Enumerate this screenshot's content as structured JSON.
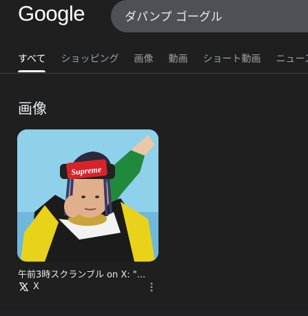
{
  "header": {
    "logo_text": "Google",
    "search_query": "ダパンプ ゴーグル"
  },
  "tabs": [
    {
      "label": "すべて",
      "active": true
    },
    {
      "label": "ショッピング",
      "active": false
    },
    {
      "label": "画像",
      "active": false
    },
    {
      "label": "動画",
      "active": false
    },
    {
      "label": "ショート動画",
      "active": false
    },
    {
      "label": "ニュース",
      "active": false
    }
  ],
  "images_section": {
    "title": "画像",
    "result": {
      "title": "午前3時スクランブル on X: \"...",
      "source": "X",
      "source_icon": "x-logo-icon",
      "thumbnail_text": "Supreme"
    }
  },
  "colors": {
    "background": "#1f1f1f",
    "search_box": "#4d5156",
    "active_tab": "#ffffff",
    "inactive_tab": "#9aa0a6",
    "supreme_red": "#d8232a"
  }
}
